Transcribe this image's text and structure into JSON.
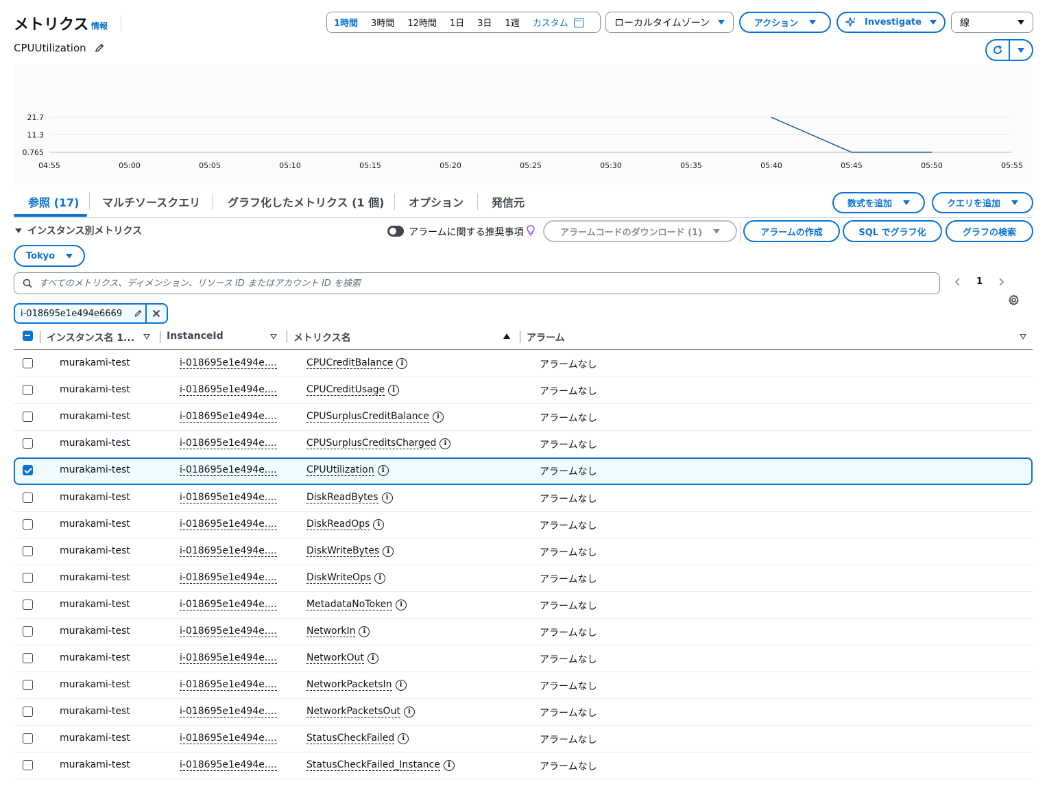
{
  "header": {
    "title": "メトリクス",
    "info": "情報",
    "subtitle": "CPUUtilization"
  },
  "time_range": {
    "options": [
      "1時間",
      "3時間",
      "12時間",
      "1日",
      "3日",
      "1週"
    ],
    "selected": "1時間",
    "custom": "カスタム"
  },
  "toolbar": {
    "timezone": "ローカルタイムゾーン",
    "actions": "アクション",
    "investigate": "Investigate",
    "graph_type": "線"
  },
  "colors": {
    "accent": "#0972d3",
    "line": "#1f5f9c",
    "text": "#0f141a"
  },
  "chart_data": {
    "type": "line",
    "y_ticks": [
      "21.7",
      "11.3",
      "0.765"
    ],
    "x_ticks": [
      "04:55",
      "05:00",
      "05:05",
      "05:10",
      "05:15",
      "05:20",
      "05:25",
      "05:30",
      "05:35",
      "05:40",
      "05:45",
      "05:50",
      "05:55"
    ],
    "ylim": [
      0.765,
      21.7
    ],
    "series": [
      {
        "x": [
          "05:40",
          "05:45",
          "05:50"
        ],
        "y": [
          21.7,
          0.765,
          0.765
        ]
      }
    ],
    "grid": true
  },
  "tabs": [
    {
      "label": "参照 (17)",
      "active": true
    },
    {
      "label": "マルチソースクエリ",
      "active": false
    },
    {
      "label": "グラフ化したメトリクス (1 個)",
      "active": false
    },
    {
      "label": "オプション",
      "active": false
    },
    {
      "label": "発信元",
      "active": false
    }
  ],
  "tab_actions": {
    "add_math": "数式を追加",
    "add_query": "クエリを追加"
  },
  "section": {
    "heading": "インスタンス別メトリクス",
    "alarm_recommend": "アラームに関する推奨事項",
    "download_alarm_code": "アラームコードのダウンロード (1)",
    "create_alarm": "アラームの作成",
    "graph_with_sql": "SQL でグラフ化",
    "graph_search": "グラフの検索",
    "region": "Tokyo"
  },
  "search": {
    "placeholder": "すべてのメトリクス、ディメンション、リソース ID またはアカウント ID を検索"
  },
  "pagination": {
    "page": "1"
  },
  "filter_token": {
    "value": "i-018695e1e494e6669"
  },
  "table": {
    "headers": {
      "instance_name": "インスタンス名 1...",
      "instance_id": "InstanceId",
      "metric_name": "メトリクス名",
      "alarm": "アラーム"
    },
    "rows": [
      {
        "name": "murakami-test",
        "id": "i-018695e1e494e....",
        "metric": "CPUCreditBalance",
        "alarm": "アラームなし",
        "checked": false
      },
      {
        "name": "murakami-test",
        "id": "i-018695e1e494e....",
        "metric": "CPUCreditUsage",
        "alarm": "アラームなし",
        "checked": false
      },
      {
        "name": "murakami-test",
        "id": "i-018695e1e494e....",
        "metric": "CPUSurplusCreditBalance",
        "alarm": "アラームなし",
        "checked": false
      },
      {
        "name": "murakami-test",
        "id": "i-018695e1e494e....",
        "metric": "CPUSurplusCreditsCharged",
        "alarm": "アラームなし",
        "checked": false
      },
      {
        "name": "murakami-test",
        "id": "i-018695e1e494e....",
        "metric": "CPUUtilization",
        "alarm": "アラームなし",
        "checked": true
      },
      {
        "name": "murakami-test",
        "id": "i-018695e1e494e....",
        "metric": "DiskReadBytes",
        "alarm": "アラームなし",
        "checked": false
      },
      {
        "name": "murakami-test",
        "id": "i-018695e1e494e....",
        "metric": "DiskReadOps",
        "alarm": "アラームなし",
        "checked": false
      },
      {
        "name": "murakami-test",
        "id": "i-018695e1e494e....",
        "metric": "DiskWriteBytes",
        "alarm": "アラームなし",
        "checked": false
      },
      {
        "name": "murakami-test",
        "id": "i-018695e1e494e....",
        "metric": "DiskWriteOps",
        "alarm": "アラームなし",
        "checked": false
      },
      {
        "name": "murakami-test",
        "id": "i-018695e1e494e....",
        "metric": "MetadataNoToken",
        "alarm": "アラームなし",
        "checked": false
      },
      {
        "name": "murakami-test",
        "id": "i-018695e1e494e....",
        "metric": "NetworkIn",
        "alarm": "アラームなし",
        "checked": false
      },
      {
        "name": "murakami-test",
        "id": "i-018695e1e494e....",
        "metric": "NetworkOut",
        "alarm": "アラームなし",
        "checked": false
      },
      {
        "name": "murakami-test",
        "id": "i-018695e1e494e....",
        "metric": "NetworkPacketsIn",
        "alarm": "アラームなし",
        "checked": false
      },
      {
        "name": "murakami-test",
        "id": "i-018695e1e494e....",
        "metric": "NetworkPacketsOut",
        "alarm": "アラームなし",
        "checked": false
      },
      {
        "name": "murakami-test",
        "id": "i-018695e1e494e....",
        "metric": "StatusCheckFailed",
        "alarm": "アラームなし",
        "checked": false
      },
      {
        "name": "murakami-test",
        "id": "i-018695e1e494e....",
        "metric": "StatusCheckFailed_Instance",
        "alarm": "アラームなし",
        "checked": false
      }
    ]
  }
}
